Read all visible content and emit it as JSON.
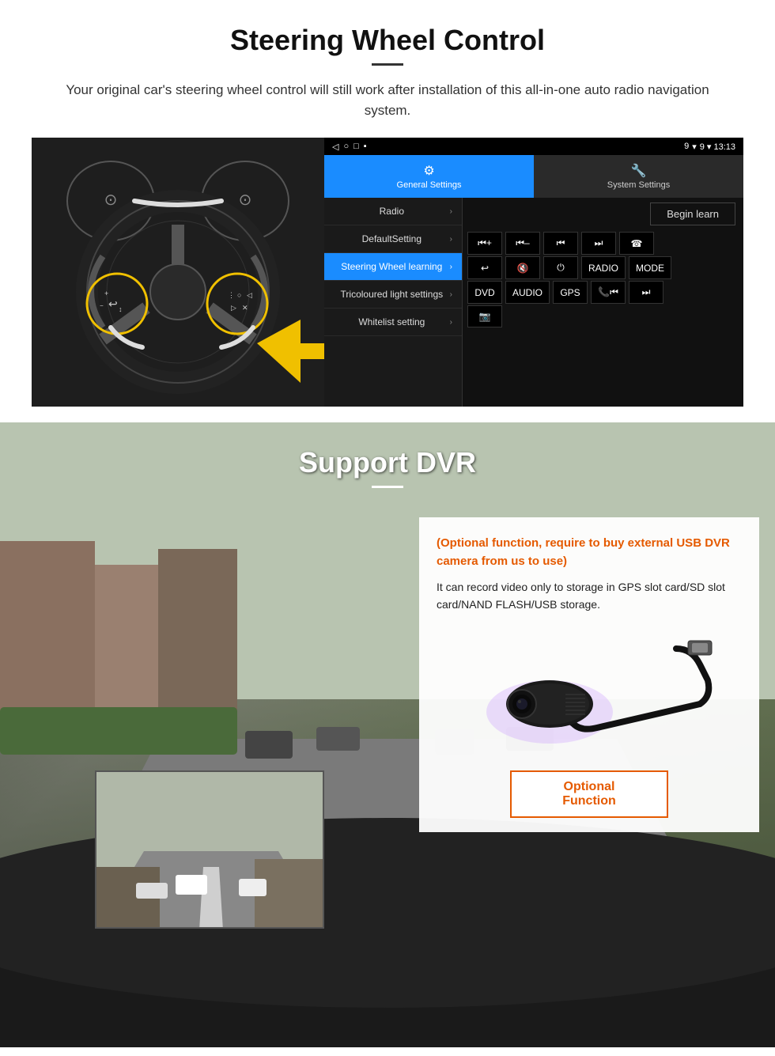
{
  "steering": {
    "title": "Steering Wheel Control",
    "subtitle": "Your original car's steering wheel control will still work after installation of this all-in-one auto radio navigation system.",
    "statusbar": {
      "nav_icons": "◁  ○  □  ■",
      "right": "9 ▾ 13:13"
    },
    "tabs": [
      {
        "label": "General Settings",
        "icon": "⚙",
        "active": true
      },
      {
        "label": "System Settings",
        "icon": "🔧",
        "active": false
      }
    ],
    "menu_items": [
      {
        "label": "Radio",
        "active": false
      },
      {
        "label": "DefaultSetting",
        "active": false
      },
      {
        "label": "Steering Wheel learning",
        "active": true
      },
      {
        "label": "Tricoloured light settings",
        "active": false
      },
      {
        "label": "Whitelist setting",
        "active": false
      }
    ],
    "begin_learn": "Begin learn",
    "ctrl_buttons_row1": [
      "⏮+",
      "⏮–",
      "⏮",
      "⏭",
      "☎"
    ],
    "ctrl_buttons_row2": [
      "↩",
      "🔇×",
      "⏻",
      "RADIO",
      "MODE"
    ],
    "ctrl_buttons_row3": [
      "DVD",
      "AUDIO",
      "GPS",
      "📞⏮",
      "⏭"
    ],
    "ctrl_buttons_row4": [
      "📷"
    ]
  },
  "dvr": {
    "title": "Support DVR",
    "optional_text": "(Optional function, require to buy external USB DVR camera from us to use)",
    "desc_text": "It can record video only to storage in GPS slot card/SD slot card/NAND FLASH/USB storage.",
    "optional_btn": "Optional Function"
  }
}
